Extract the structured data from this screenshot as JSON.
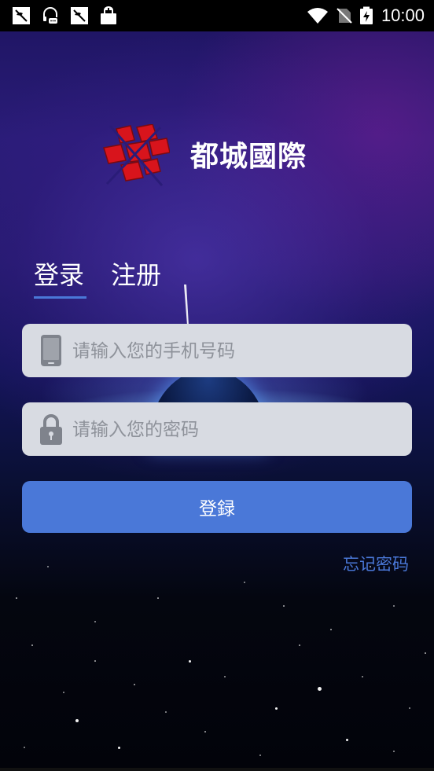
{
  "status_bar": {
    "time": "10:00",
    "notification_icons": [
      "muted-phone-icon",
      "headset-chat-icon",
      "muted-phone-icon",
      "shopping-bag-icon"
    ],
    "system_icons": [
      "wifi-icon",
      "no-sim-icon",
      "battery-charging-icon"
    ]
  },
  "brand": {
    "name": "都城國際",
    "logo_color": "#d8141c"
  },
  "tabs": [
    {
      "label": "登录",
      "active": true
    },
    {
      "label": "注册",
      "active": false
    }
  ],
  "form": {
    "phone_placeholder": "请输入您的手机号码",
    "password_placeholder": "请输入您的密码",
    "submit_label": "登録",
    "forgot_label": "忘记密码"
  },
  "colors": {
    "accent": "#4a78d8",
    "field_bg": "#d8dbe2"
  }
}
